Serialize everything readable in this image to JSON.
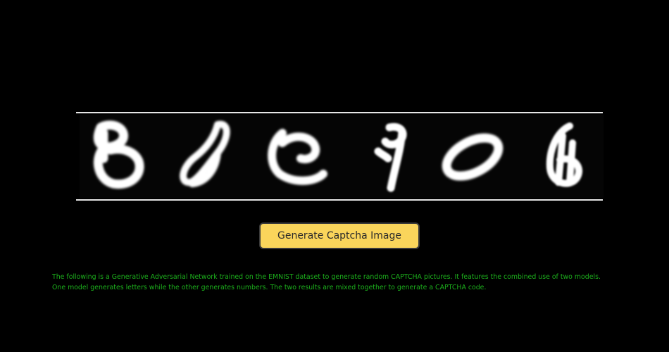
{
  "captcha": {
    "characters": [
      "8",
      "8",
      "C",
      "9",
      "0",
      "6"
    ],
    "glyph_color": "#ffffff",
    "background_color": "#000000"
  },
  "button": {
    "label": "Generate Captcha Image",
    "color": "#fad55b"
  },
  "description": {
    "text": "The following is a Generative Adversarial Network trained on the EMNIST dataset to generate random CAPTCHA pictures. It features the combined use of two models. One model generates letters while the other generates numbers. The two results are mixed together to generate a CAPTCHA code.",
    "color": "#1cb01c"
  }
}
